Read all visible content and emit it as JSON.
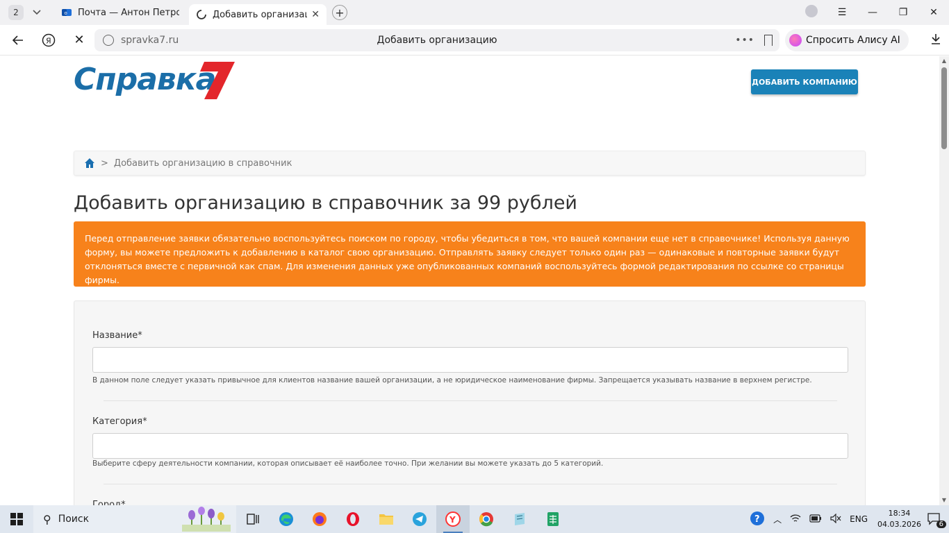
{
  "browser": {
    "tab_count": "2",
    "tabs": [
      {
        "title": "Почта — Антон Петров — Яндекс Почта",
        "active": false
      },
      {
        "title": "Добавить организацию",
        "active": true
      }
    ],
    "address": {
      "domain": "spravka7.ru",
      "page_title": "Добавить организацию"
    },
    "alice_label": "Спросить Алису AI"
  },
  "site": {
    "logo_text": "Справка",
    "add_company_label": "ДОБАВИТЬ КОМПАНИЮ",
    "breadcrumb": {
      "separator": ">",
      "current": "Добавить организацию в справочник"
    },
    "page_title": "Добавить организацию в справочник за 99 рублей",
    "notice": "Перед отправление заявки обязательно воспользуйтесь поиском по городу, чтобы убедиться в том, что вашей компании еще нет в справочнике! Используя данную форму, вы можете предложить к добавлению в каталог свою организацию. Отправлять заявку следует только один раз — одинаковые и повторные заявки будут отклоняться вместе с первичной как спам. Для изменения данных уже опубликованных компаний воспользуйтесь формой редактирования по ссылке со страницы фирмы.",
    "form": {
      "name_label": "Название*",
      "name_value": "",
      "name_help": "В данном поле следует указать привычное для клиентов название вашей организации, а не юридическое наименование фирмы. Запрещается указывать название в верхнем регистре.",
      "category_label": "Категория*",
      "category_value": "",
      "category_help": "Выберите сферу деятельности компании, которая описывает её наиболее точно. При желании вы можете указать до 5 категорий.",
      "city_label": "Город*"
    }
  },
  "taskbar": {
    "search_label": "Поиск",
    "language": "ENG",
    "time": "18:34",
    "date": "04.03.2026",
    "notifications": "6"
  },
  "colors": {
    "brand_blue": "#1b6ea8",
    "brand_red": "#e3262b",
    "button_blue": "#1a82b8",
    "notice_orange": "#f7821b"
  }
}
